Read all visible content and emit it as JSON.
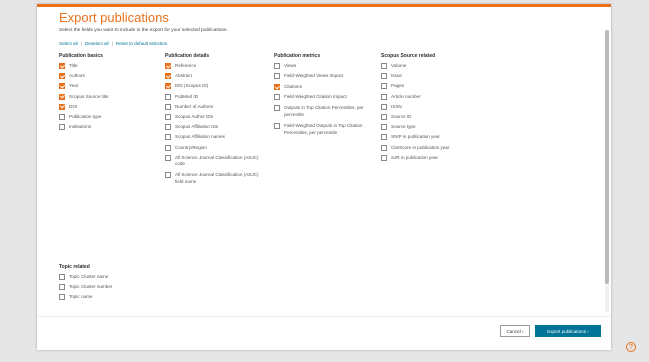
{
  "dialog": {
    "title": "Export publications",
    "description": "Select the fields you want to include in the export for your selected publications.",
    "select_all": "Select all",
    "deselect_all": "Deselect all",
    "reset_default": "Reset to default selection",
    "separator": "|"
  },
  "columns": [
    {
      "title": "Publication basics",
      "options": [
        {
          "label": "Title",
          "checked": true
        },
        {
          "label": "Authors",
          "checked": true
        },
        {
          "label": "Year",
          "checked": true
        },
        {
          "label": "Scopus Source title",
          "checked": true
        },
        {
          "label": "DOI",
          "checked": true
        },
        {
          "label": "Publication type",
          "checked": false
        },
        {
          "label": "Institutions",
          "checked": false
        }
      ]
    },
    {
      "title": "Publication details",
      "options": [
        {
          "label": "Reference",
          "checked": true
        },
        {
          "label": "Abstract",
          "checked": true
        },
        {
          "label": "EID (Scopus ID)",
          "checked": true
        },
        {
          "label": "PubMed ID",
          "checked": false
        },
        {
          "label": "Number of Authors",
          "checked": false
        },
        {
          "label": "Scopus Author IDs",
          "checked": false
        },
        {
          "label": "Scopus Affiliation IDs",
          "checked": false
        },
        {
          "label": "Scopus Affiliation names",
          "checked": false
        },
        {
          "label": "Country/Region",
          "checked": false
        },
        {
          "label": "All Science Journal Classification (ASJC) code",
          "checked": false
        },
        {
          "label": "All Science Journal Classification (ASJC) field name",
          "checked": false
        }
      ]
    },
    {
      "title": "Publication metrics",
      "options": [
        {
          "label": "Views",
          "checked": false
        },
        {
          "label": "Field-Weighted Views Impact",
          "checked": false
        },
        {
          "label": "Citations",
          "checked": true
        },
        {
          "label": "Field-Weighted Citation Impact",
          "checked": false
        },
        {
          "label": "Outputs in Top Citation Percentiles, per percentile",
          "checked": false
        },
        {
          "label": "Field-Weighted Outputs in Top Citation Percentiles, per percentile",
          "checked": false
        }
      ]
    },
    {
      "title": "Scopus Source related",
      "options": [
        {
          "label": "Volume",
          "checked": false
        },
        {
          "label": "Issue",
          "checked": false
        },
        {
          "label": "Pages",
          "checked": false
        },
        {
          "label": "Article number",
          "checked": false
        },
        {
          "label": "ISSN",
          "checked": false
        },
        {
          "label": "Source ID",
          "checked": false
        },
        {
          "label": "Source type",
          "checked": false
        },
        {
          "label": "SNIP in publication year",
          "checked": false
        },
        {
          "label": "CiteScore in publication year",
          "checked": false
        },
        {
          "label": "SJR in publication year",
          "checked": false
        }
      ]
    },
    {
      "title": "Topic related",
      "options": [
        {
          "label": "Topic Cluster name",
          "checked": false
        },
        {
          "label": "Topic Cluster number",
          "checked": false
        },
        {
          "label": "Topic name",
          "checked": false
        }
      ]
    }
  ],
  "footer": {
    "cancel_label": "Cancel",
    "export_label": "Export publications"
  },
  "help": {
    "label": "?"
  },
  "colors": {
    "accent": "#e9711c",
    "primary": "#007398"
  }
}
